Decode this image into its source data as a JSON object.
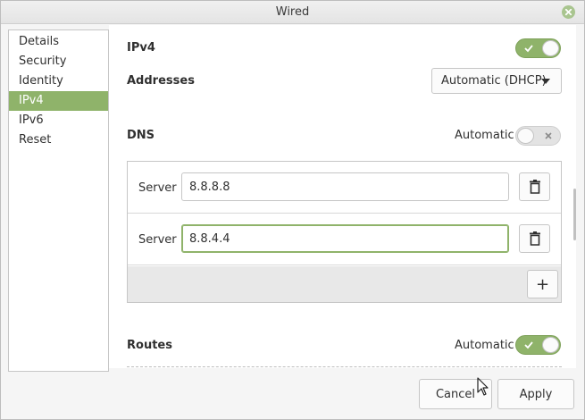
{
  "window": {
    "title": "Wired"
  },
  "sidebar": {
    "items": [
      {
        "label": "Details"
      },
      {
        "label": "Security"
      },
      {
        "label": "Identity"
      },
      {
        "label": "IPv4"
      },
      {
        "label": "IPv6"
      },
      {
        "label": "Reset"
      }
    ],
    "selected": "IPv4"
  },
  "ipv4": {
    "heading": "IPv4",
    "enabled": true,
    "addresses_label": "Addresses",
    "addresses_method": "Automatic (DHCP)"
  },
  "dns": {
    "heading": "DNS",
    "automatic_label": "Automatic",
    "automatic": false,
    "server_label": "Server",
    "servers": [
      "8.8.8.8",
      "8.8.4.4"
    ],
    "add_icon": "+"
  },
  "routes": {
    "heading": "Routes",
    "automatic_label": "Automatic",
    "automatic": true
  },
  "footer": {
    "cancel_label": "Cancel",
    "apply_label": "Apply"
  },
  "colors": {
    "accent": "#8fb36a",
    "window_bg": "#f5f5f5"
  }
}
